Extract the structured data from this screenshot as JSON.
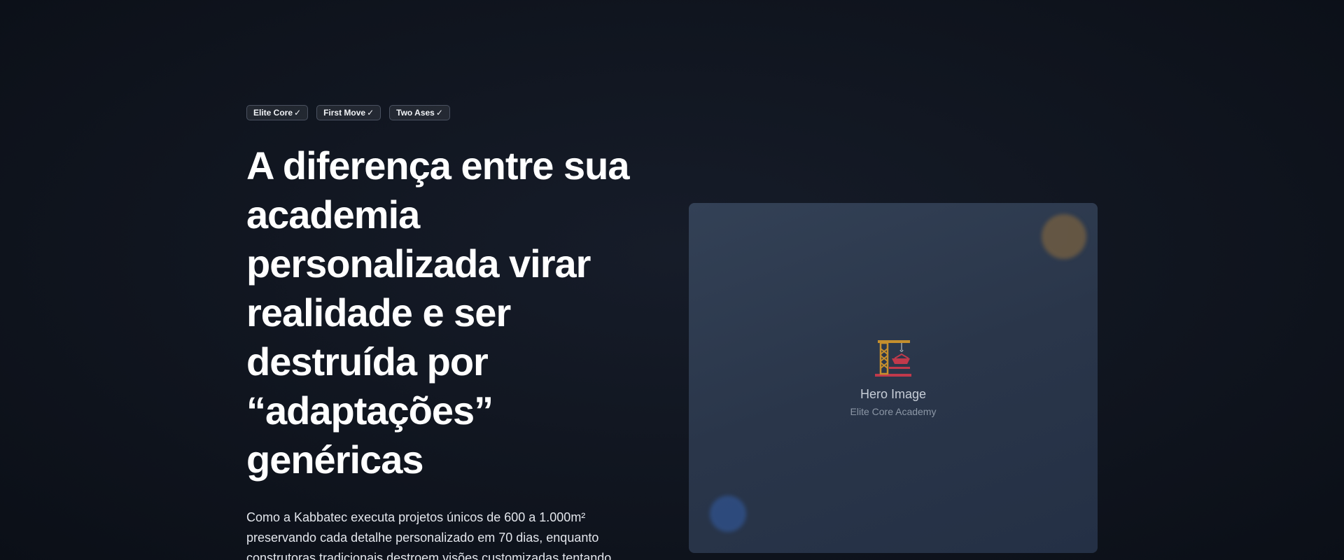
{
  "badges": [
    {
      "label": "Elite Core",
      "check": "✓"
    },
    {
      "label": "First Move",
      "check": "✓"
    },
    {
      "label": "Two Ases",
      "check": "✓"
    }
  ],
  "hero": {
    "headline": "A diferença entre sua academia personalizada virar realidade e ser destruída por “adaptações” genéricas",
    "subtext": "Como a Kabbatec executa projetos únicos de 600 a 1.000m² preservando cada detalhe personalizado em 70 dias, enquanto construtoras tradicionais destroem visões customizadas tentando"
  },
  "media": {
    "icon": "construction-crane-icon",
    "title": "Hero Image",
    "subtitle": "Elite Core Academy"
  },
  "colors": {
    "background": "#0f141d",
    "card": "#2d394d",
    "accent_orb_amber": "#6b5a43",
    "accent_orb_blue": "#2f4f86"
  }
}
